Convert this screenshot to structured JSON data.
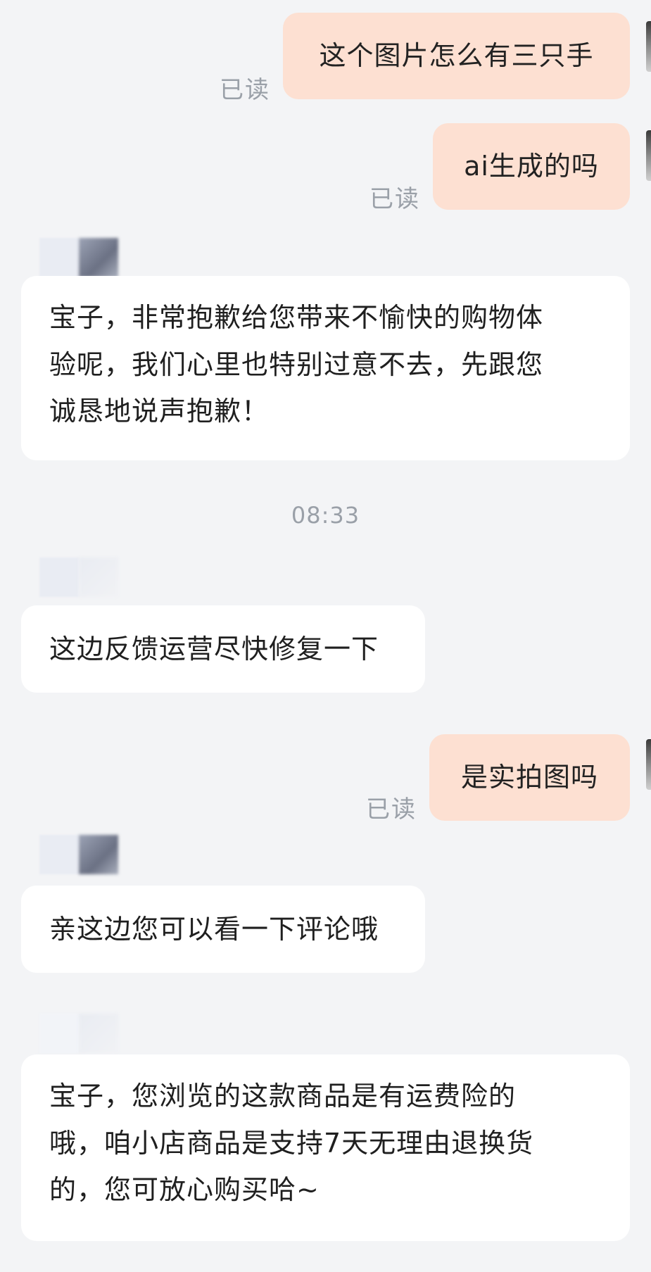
{
  "messages": [
    {
      "side": "out",
      "text": "这个图片怎么有三只手",
      "status": "已读"
    },
    {
      "side": "out",
      "text": "ai生成的吗",
      "status": "已读"
    },
    {
      "side": "in",
      "lines": [
        "宝子，非常抱歉给您带来不愉快的购物体",
        "验呢，我们心里也特别过意不去，先跟您",
        "诚恳地说声抱歉！"
      ]
    },
    {
      "side": "in",
      "text": "这边反馈运营尽快修复一下"
    },
    {
      "side": "out",
      "text": "是实拍图吗",
      "status": "已读"
    },
    {
      "side": "in",
      "text": "亲这边您可以看一下评论哦"
    },
    {
      "side": "in",
      "lines": [
        "宝子，您浏览的这款商品是有运费险的",
        "哦，咱小店商品是支持7天无理由退换货",
        "的，您可放心购买哈~"
      ]
    }
  ],
  "timestamp": "08:33",
  "colors": {
    "outgoing_bubble": "#fde0d2",
    "incoming_bubble": "#ffffff",
    "background": "#f3f4f6",
    "muted_text": "#9aa0a8"
  }
}
